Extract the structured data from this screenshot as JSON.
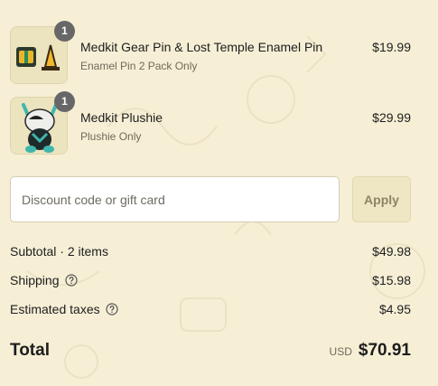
{
  "items": [
    {
      "title": "Medkit Gear Pin & Lost Temple Enamel Pin",
      "variant": "Enamel Pin 2 Pack Only",
      "price": "$19.99",
      "quantity": "1"
    },
    {
      "title": "Medkit Plushie",
      "variant": "Plushie Only",
      "price": "$29.99",
      "quantity": "1"
    }
  ],
  "discount": {
    "placeholder": "Discount code or gift card",
    "apply_label": "Apply"
  },
  "summary": {
    "subtotal_label": "Subtotal · 2 items",
    "subtotal_value": "$49.98",
    "shipping_label": "Shipping",
    "shipping_value": "$15.98",
    "taxes_label": "Estimated taxes",
    "taxes_value": "$4.95",
    "total_label": "Total",
    "total_currency": "USD",
    "total_value": "$70.91"
  },
  "colors": {
    "background": "#f6efd6",
    "badge": "#676767",
    "apply_button": "#efe6c4"
  }
}
